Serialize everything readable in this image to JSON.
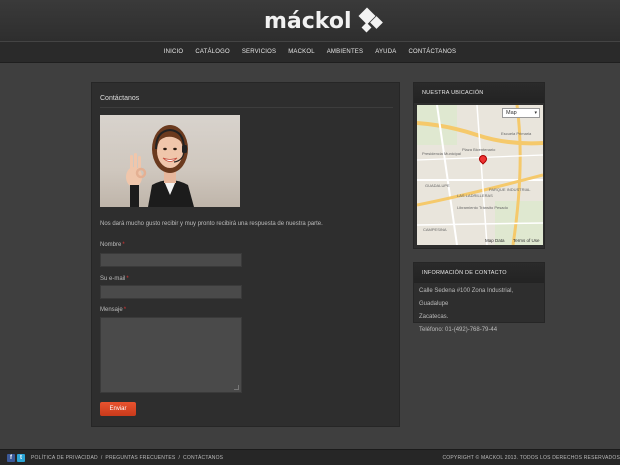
{
  "brand": {
    "name": "máckol"
  },
  "nav": {
    "items": [
      "INICIO",
      "CATÁLOGO",
      "SERVICIOS",
      "MACKOL",
      "AMBIENTES",
      "AYUDA",
      "CONTÁCTANOS"
    ]
  },
  "contact_page": {
    "title": "Contáctanos",
    "intro": "Nos dará mucho gusto recibir y muy pronto recibirá una respuesta de nuestra parte.",
    "name_label": "Nombre",
    "email_label": "Su e-mail",
    "message_label": "Mensaje",
    "required_mark": "*",
    "submit_label": "Enviar"
  },
  "map_widget": {
    "title": "NUESTRA UBICACIÓN",
    "map_type": "Map",
    "map_data": "Map Data",
    "terms": "Terms of Use",
    "streets": [
      "Presidencia Municipal",
      "Plaza Bicentenario",
      "LAS LADRILLERAS",
      "GUADALUPE",
      "PARQUE INDUSTRIAL",
      "CAMPESINA",
      "Libramiento Tránsito Pesado",
      "Escuela Primaria"
    ]
  },
  "contact_info": {
    "title": "INFORMACIÓN DE CONTACTO",
    "address_1": "Calle Sedena #100 Zona Industrial, Guadalupe",
    "address_2": "Zacatecas.",
    "phone": "Teléfono: 01-(492)-768-79-44"
  },
  "footer": {
    "links": [
      "POLÍTICA DE PRIVACIDAD",
      "PREGUNTAS FRECUENTES",
      "CONTÁCTANOS"
    ],
    "separator": "/",
    "copyright": "COPYRIGHT © MACKOL 2013. TODOS LOS DERECHOS RESERVADOS"
  },
  "colors": {
    "accent": "#d9431f",
    "facebook": "#3b5998",
    "twitter": "#2ba5d6"
  }
}
